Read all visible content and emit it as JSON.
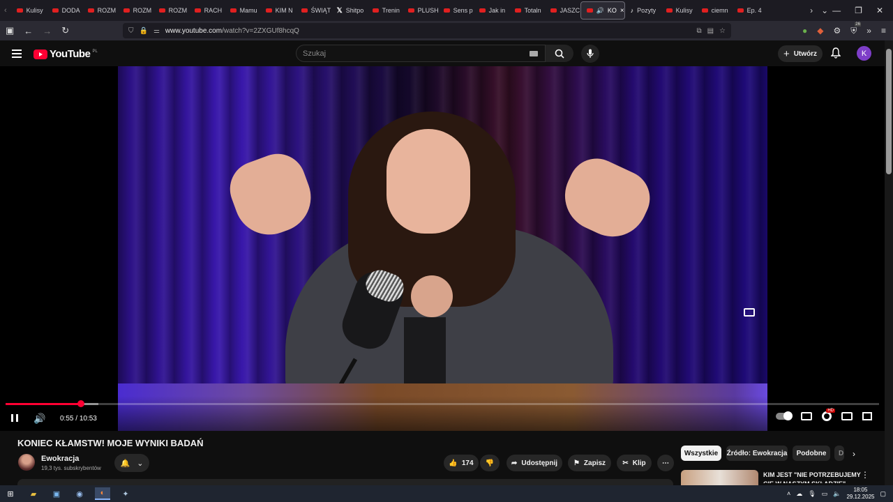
{
  "browser": {
    "tabs": [
      {
        "label": "Kulisy",
        "icon": "youtube-icon"
      },
      {
        "label": "DODA",
        "icon": "youtube-icon"
      },
      {
        "label": "ROZM",
        "icon": "youtube-icon"
      },
      {
        "label": "ROZM",
        "icon": "youtube-icon"
      },
      {
        "label": "ROZM",
        "icon": "youtube-icon"
      },
      {
        "label": "RACH",
        "icon": "youtube-icon"
      },
      {
        "label": "Mamu",
        "icon": "youtube-icon"
      },
      {
        "label": "KIM N",
        "icon": "youtube-icon"
      },
      {
        "label": "ŚWIĄT",
        "icon": "youtube-icon"
      },
      {
        "label": "Shitpo",
        "icon": "x-icon"
      },
      {
        "label": "Trenin",
        "icon": "youtube-icon"
      },
      {
        "label": "PLUSH",
        "icon": "youtube-icon"
      },
      {
        "label": "Sens p",
        "icon": "youtube-icon"
      },
      {
        "label": "Jak in",
        "icon": "youtube-icon"
      },
      {
        "label": "Totaln",
        "icon": "youtube-icon"
      },
      {
        "label": "JASZC",
        "icon": "youtube-icon"
      }
    ],
    "active_tab": {
      "label": "KO",
      "close": "×"
    },
    "tabs_after": [
      {
        "label": "Pozyty",
        "icon": "tiktok-icon"
      },
      {
        "label": "Kulisy",
        "icon": "youtube-icon"
      },
      {
        "label": "ciemn",
        "icon": "youtube-icon"
      },
      {
        "label": "Ep. 4",
        "icon": "youtube-icon"
      }
    ],
    "url_host": "www.youtube.com",
    "url_path": "/watch?v=2ZXGUf8hcqQ",
    "extension_badge": "26"
  },
  "youtube": {
    "logo_text": "YouTube",
    "logo_country": "PL",
    "search_placeholder": "Szukaj",
    "create_label": "Utwórz",
    "avatar_letter": "K"
  },
  "player": {
    "time_current": "0:55",
    "time_separator": " / ",
    "time_total": "10:53",
    "played_fraction": 0.086,
    "loaded_fraction": 0.106,
    "hd_badge": "HD"
  },
  "video": {
    "title": "KONIEC KŁAMSTW! MOJE WYNIKI BADAŃ",
    "channel_name": "Ewokracja",
    "subscribers": "19,3 tys. subskrybentów",
    "likes": "174",
    "share_label": "Udostępnij",
    "save_label": "Zapisz",
    "clip_label": "Klip"
  },
  "recommendations": {
    "chips": [
      "Wszystkie",
      "Źródło: Ewokracja",
      "Podobne",
      "D"
    ],
    "first_title": "KIM JEST \"NIE POTRZEBUJEMY CIĘ W NASZYM SKŁADZIE\""
  },
  "taskbar": {
    "time": "18:05",
    "date": "29.12.2025"
  }
}
